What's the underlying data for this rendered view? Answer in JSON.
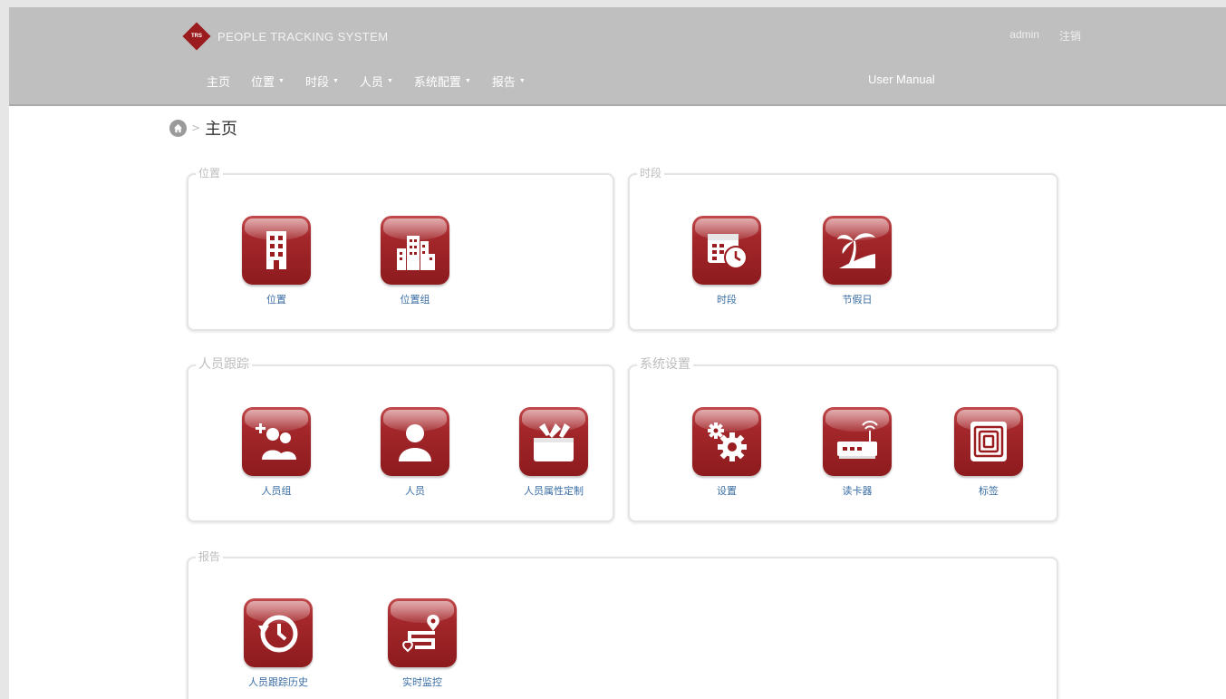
{
  "header": {
    "brand_logo_text": "TRS",
    "brand_title": "PEOPLE TRACKING SYSTEM",
    "user": "admin",
    "logout": "注销",
    "menu": [
      {
        "label": "主页",
        "dropdown": false
      },
      {
        "label": "位置",
        "dropdown": true
      },
      {
        "label": "时段",
        "dropdown": true
      },
      {
        "label": "人员",
        "dropdown": true
      },
      {
        "label": "系统配置",
        "dropdown": true
      },
      {
        "label": "报告",
        "dropdown": true
      }
    ],
    "user_manual": "User Manual",
    "caret": "▼"
  },
  "breadcrumb": {
    "separator": ">",
    "current": "主页"
  },
  "panels": {
    "location": {
      "title": "位置",
      "items": [
        {
          "label": "位置",
          "icon": "building-icon"
        },
        {
          "label": "位置组",
          "icon": "buildings-icon"
        }
      ]
    },
    "timeslot": {
      "title": "时段",
      "items": [
        {
          "label": "时段",
          "icon": "calendar-clock-icon"
        },
        {
          "label": "节假日",
          "icon": "palm-tree-icon"
        }
      ]
    },
    "personnel": {
      "title": "人员跟踪",
      "items": [
        {
          "label": "人员组",
          "icon": "add-group-icon"
        },
        {
          "label": "人员",
          "icon": "person-icon"
        },
        {
          "label": "人员属性定制",
          "icon": "toolbox-icon"
        }
      ]
    },
    "system": {
      "title": "系统设置",
      "items": [
        {
          "label": "设置",
          "icon": "gears-icon"
        },
        {
          "label": "读卡器",
          "icon": "router-icon"
        },
        {
          "label": "标签",
          "icon": "rfid-tag-icon"
        }
      ]
    },
    "report": {
      "title": "报告",
      "items": [
        {
          "label": "人员跟踪历史",
          "icon": "history-icon"
        },
        {
          "label": "实时监控",
          "icon": "route-pin-icon"
        }
      ]
    }
  },
  "colors": {
    "tile": "#9b1c1f",
    "navbar": "#bfbfbf",
    "link": "#3a6ea5"
  }
}
